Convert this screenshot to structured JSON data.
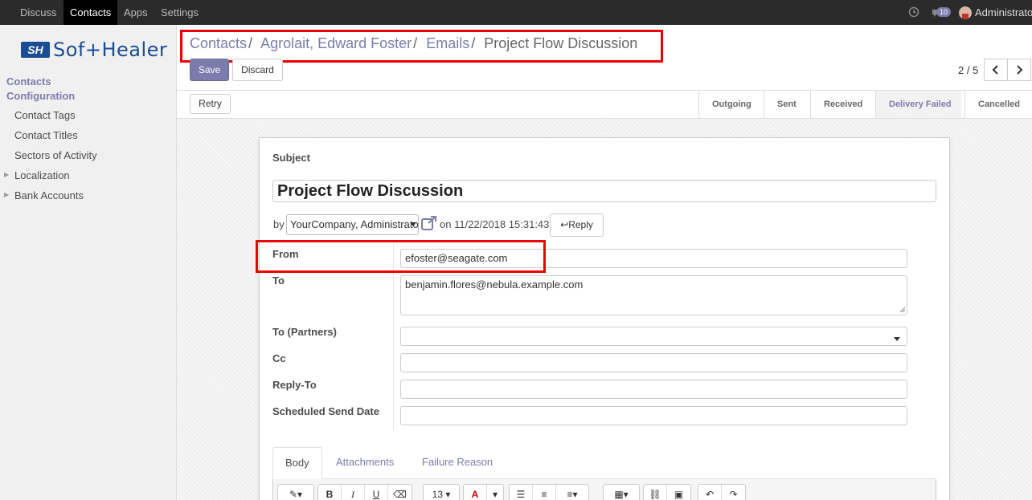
{
  "topbar": {
    "menu": [
      "Discuss",
      "Contacts",
      "Apps",
      "Settings"
    ],
    "active_menu": "Contacts",
    "chat_count": "10",
    "user": "Administrator"
  },
  "sidebar": {
    "logo_mark": "SH",
    "logo_text": "Sof+Healer",
    "section_contacts": "Contacts",
    "section_configuration": "Configuration",
    "items": [
      "Contact Tags",
      "Contact Titles",
      "Sectors of Activity",
      "Localization",
      "Bank Accounts"
    ]
  },
  "breadcrumb": {
    "items": [
      "Contacts",
      "Agrolait, Edward Foster",
      "Emails"
    ],
    "separator": "/",
    "current": "Project Flow Discussion"
  },
  "buttons": {
    "save": "Save",
    "discard": "Discard",
    "retry": "Retry",
    "reply": "Reply"
  },
  "pager": {
    "value": "2 / 5"
  },
  "statusbar": {
    "stages": [
      "Outgoing",
      "Sent",
      "Received",
      "Delivery Failed",
      "Cancelled"
    ],
    "active_stage": "Delivery Failed"
  },
  "form": {
    "subject_label": "Subject",
    "subject_value": "Project Flow Discussion",
    "by_label": "by",
    "author_value": "YourCompany, Administrator",
    "on_text": "on 11/22/2018 15:31:43",
    "from_label": "From",
    "from_value": "efoster@seagate.com",
    "to_label": "To",
    "to_value": "benjamin.flores@nebula.example.com",
    "to_partners_label": "To (Partners)",
    "to_partners_value": "",
    "cc_label": "Cc",
    "cc_value": "",
    "reply_to_label": "Reply-To",
    "reply_to_value": "",
    "scheduled_label": "Scheduled Send Date",
    "scheduled_value": ""
  },
  "tabs": [
    "Body",
    "Attachments",
    "Failure Reason"
  ],
  "editor": {
    "font_size": "13"
  },
  "colors": {
    "accent": "#7c7bad",
    "highlight": "#e00000",
    "navbar": "#2b2b2b"
  }
}
